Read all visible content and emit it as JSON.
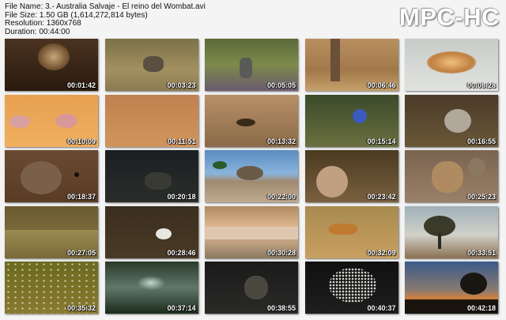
{
  "header": {
    "file_name": "File Name: 3.- Australia Salvaje - El reino del Wombat.avi",
    "file_size": "File Size: 1.50 GB (1,614,272,814 bytes)",
    "resolution": "Resolution: 1360x768",
    "duration": "Duration: 00:44:00",
    "brand": "MPC-HC"
  },
  "thumbnails": [
    {
      "time": "00:01:42",
      "logo": "",
      "bg": "linear-gradient(180deg,#4a3320,#2a1a0e)",
      "shape": "burrow"
    },
    {
      "time": "00:03:23",
      "logo": "",
      "bg": "linear-gradient(180deg,#7a7248,#a39060 60%,#8b7a52)",
      "shape": "animal-mid"
    },
    {
      "time": "00:05:05",
      "logo": "",
      "bg": "linear-gradient(180deg,#5a6a3a,#7d8a4a 50%,#6a5a70)",
      "shape": "plants"
    },
    {
      "time": "00:06:46",
      "logo": "",
      "bg": "linear-gradient(180deg,#b89060,#a0784a 60%,#c7a06a)",
      "shape": "trunk"
    },
    {
      "time": "00:08:28",
      "logo": "",
      "bg": "linear-gradient(180deg,#c8ccc8,#e0e2de)",
      "shape": "nest"
    },
    {
      "time": "00:10:09",
      "logo": "",
      "bg": "linear-gradient(180deg,#e6a050,#f0b060)",
      "shape": "birds"
    },
    {
      "time": "00:11:51",
      "logo": "",
      "bg": "linear-gradient(180deg,#c08050,#d0955c)",
      "shape": "none"
    },
    {
      "time": "00:13:32",
      "logo": "",
      "bg": "linear-gradient(180deg,#b89068,#8a6a48)",
      "shape": "bugs"
    },
    {
      "time": "00:15:14",
      "logo": "",
      "bg": "linear-gradient(180deg,#3a4a2a,#6a7040)",
      "shape": "bluebird"
    },
    {
      "time": "00:16:55",
      "logo": "",
      "bg": "linear-gradient(180deg,#4a3a28,#6a5838)",
      "shape": "nestbird"
    },
    {
      "time": "00:18:37",
      "logo": "",
      "bg": "linear-gradient(180deg,#6a4a30,#5a3c26)",
      "shape": "eye"
    },
    {
      "time": "00:20:18",
      "logo": "",
      "bg": "linear-gradient(180deg,#1a1e22,#2a2e2a)",
      "shape": "dark-animal"
    },
    {
      "time": "00:22:00",
      "logo": "",
      "bg": "linear-gradient(180deg,#5a8cc0 0%,#8ab4dc 45%,#a08a70 60%,#c0aa90)",
      "shape": "wombat-sky"
    },
    {
      "time": "00:23:42",
      "logo": "",
      "bg": "linear-gradient(180deg,#4a3a20,#7a6040)",
      "shape": "wallaby"
    },
    {
      "time": "00:25:23",
      "logo": "",
      "bg": "linear-gradient(180deg,#7a6450,#9a8068)",
      "shape": "wallaby2"
    },
    {
      "time": "00:27:05",
      "logo": "",
      "bg": "linear-gradient(180deg,#6a5a30,#8a7a46)",
      "shape": "grass"
    },
    {
      "time": "00:28:46",
      "logo": "",
      "bg": "linear-gradient(180deg,#3a2e1e,#4a3a26)",
      "shape": "bird-dark"
    },
    {
      "time": "00:30:28",
      "logo": "",
      "bg": "linear-gradient(180deg,#b08a60 0%,#e0b890 40%,#c0a080 70%,#8a7a60)",
      "shape": "plain"
    },
    {
      "time": "00:32:09",
      "logo": "",
      "bg": "linear-gradient(180deg,#a88a50,#c8a060)",
      "shape": "dingo"
    },
    {
      "time": "00:33:51",
      "logo": "",
      "bg": "linear-gradient(180deg,#a0b0b8 0%,#d0d0c8 55%,#8a7050)",
      "shape": "tree"
    },
    {
      "time": "00:35:32",
      "logo": "",
      "bg": "linear-gradient(180deg,#6a6a20,#8a7a30)",
      "shape": "dots"
    },
    {
      "time": "00:37:14",
      "logo": "",
      "bg": "linear-gradient(180deg,#2a3a2a,#60786a 50%,#1a2a1a)",
      "shape": "underwater"
    },
    {
      "time": "00:38:55",
      "logo": "",
      "bg": "linear-gradient(180deg,#1a1a1a,#2a2a28)",
      "shape": "dark2"
    },
    {
      "time": "00:40:37",
      "logo": "",
      "bg": "linear-gradient(180deg,#101010,#1e1e1e)",
      "shape": "echidna"
    },
    {
      "time": "00:42:18",
      "logo": "",
      "bg": "linear-gradient(180deg,#3a5a8a 0%,#8a7a70 55%,#d08040 70%,#2a2018)",
      "shape": "sunset"
    }
  ]
}
